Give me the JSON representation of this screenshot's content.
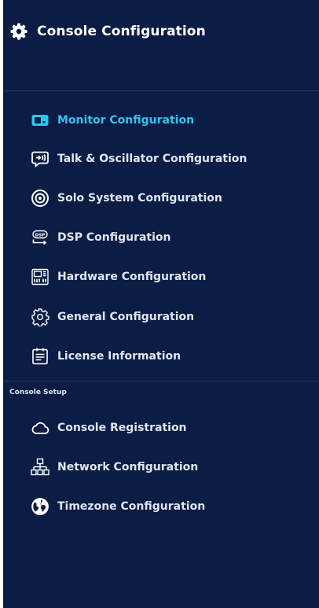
{
  "header": {
    "title": "Console Configuration",
    "icon": "gear-icon"
  },
  "colors": {
    "background": "#0b1d45",
    "active": "#31c3ef",
    "text": "#dfe5f1"
  },
  "menu": {
    "items": [
      {
        "label": "Monitor Configuration",
        "icon": "monitor-icon",
        "active": true
      },
      {
        "label": "Talk & Oscillator Configuration",
        "icon": "talk-icon",
        "active": false
      },
      {
        "label": "Solo System Configuration",
        "icon": "target-icon",
        "active": false
      },
      {
        "label": "DSP Configuration",
        "icon": "dsp-icon",
        "active": false
      },
      {
        "label": "Hardware Configuration",
        "icon": "hardware-icon",
        "active": false
      },
      {
        "label": "General Configuration",
        "icon": "gear-outline-icon",
        "active": false
      },
      {
        "label": "License Information",
        "icon": "document-icon",
        "active": false
      }
    ]
  },
  "console_setup": {
    "section_label": "Console Setup",
    "items": [
      {
        "label": "Console Registration",
        "icon": "cloud-icon"
      },
      {
        "label": "Network Configuration",
        "icon": "network-icon"
      },
      {
        "label": "Timezone Configuration",
        "icon": "globe-icon"
      }
    ]
  }
}
